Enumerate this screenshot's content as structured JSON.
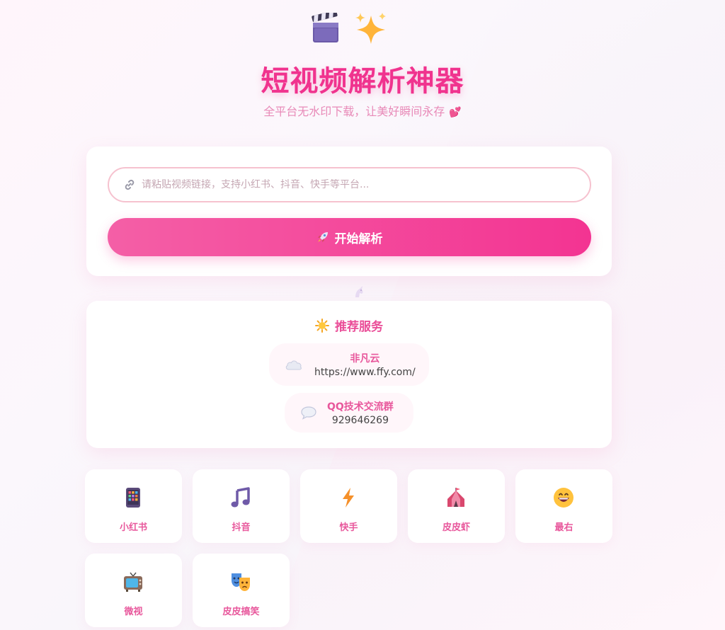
{
  "header": {
    "title": "短视频解析神器",
    "subtitle": "全平台无水印下载，让美好瞬间永存",
    "subtitle_emoji": "💕"
  },
  "parser": {
    "url_placeholder": "请粘贴视频链接，支持小红书、抖音、快手等平台...",
    "url_value": "",
    "button_label": "开始解析"
  },
  "services": {
    "title": "推荐服务",
    "items": [
      {
        "name": "非凡云",
        "value": "https://www.ffy.com/",
        "icon": "cloud-icon"
      },
      {
        "name": "QQ技术交流群",
        "value": "929646269",
        "icon": "speech-bubble-icon"
      }
    ]
  },
  "platforms": [
    {
      "label": "小红书",
      "icon": "phone-icon"
    },
    {
      "label": "抖音",
      "icon": "music-note-icon"
    },
    {
      "label": "快手",
      "icon": "lightning-icon"
    },
    {
      "label": "皮皮虾",
      "icon": "circus-tent-icon"
    },
    {
      "label": "最右",
      "icon": "grin-face-icon"
    },
    {
      "label": "微视",
      "icon": "tv-icon"
    },
    {
      "label": "皮皮搞笑",
      "icon": "theater-masks-icon"
    }
  ],
  "colors": {
    "accent": "#f0338e",
    "button_start": "#f45fa6",
    "button_end": "#f33492",
    "label_pink": "#e8589c"
  }
}
